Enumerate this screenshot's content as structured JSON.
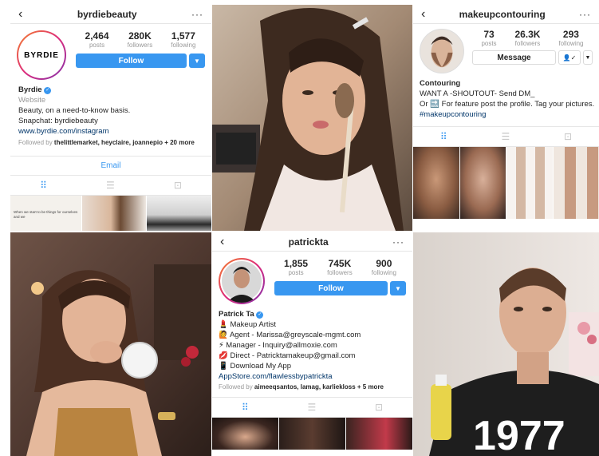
{
  "byrdie": {
    "username": "byrdiebeauty",
    "avatar_text": "BYRDIE",
    "stats": [
      {
        "value": "2,464",
        "label": "posts"
      },
      {
        "value": "280K",
        "label": "followers"
      },
      {
        "value": "1,577",
        "label": "following"
      }
    ],
    "follow_label": "Follow",
    "name": "Byrdie",
    "category": "Website",
    "bio_lines": [
      "Beauty, on a need-to-know basis.",
      "Snapchat: byrdiebeauty"
    ],
    "link": "www.byrdie.com/instagram",
    "followed_by_prefix": "Followed by ",
    "followed_by_names": "thelittlemarket, heyclaire, joannepio",
    "followed_by_suffix": " + 20 more",
    "email_label": "Email"
  },
  "makeup": {
    "username": "makeupcontouring",
    "stats": [
      {
        "value": "73",
        "label": "posts"
      },
      {
        "value": "26.3K",
        "label": "followers"
      },
      {
        "value": "293",
        "label": "following"
      }
    ],
    "message_label": "Message",
    "name": "Contouring",
    "bio_lines": [
      "WANT A -SHOUTOUT- Send DM_",
      "Or 🔜 For feature post the profile. Tag your pictures.",
      "#makeupcontouring"
    ]
  },
  "patrick": {
    "username": "patrickta",
    "stats": [
      {
        "value": "1,855",
        "label": "posts"
      },
      {
        "value": "745K",
        "label": "followers"
      },
      {
        "value": "900",
        "label": "following"
      }
    ],
    "follow_label": "Follow",
    "name": "Patrick Ta",
    "bio_lines": [
      "💄 Makeup Artist",
      "🙋 Agent - Marissa@greyscale-mgmt.com",
      "⚡ Manager - Inquiry@allmoxie.com",
      "💋 Direct - Patricktamakeup@gmail.com",
      "📱 Download My App"
    ],
    "link": "AppStore.com/flawlessbypatrickta",
    "followed_by_prefix": "Followed by ",
    "followed_by_names": "aimeeqsantos, lamag, karliekloss",
    "followed_by_suffix": " + 5 more"
  },
  "photo_text": {
    "shirt_number": "1977",
    "byrdie_thumb_caption": "When we start to be things for ourselves and we"
  },
  "icons": {
    "back": "‹",
    "more": "···",
    "caret": "▼",
    "grid": "⠿",
    "list": "☰",
    "tagged": "⊡",
    "user_check": "👤✓"
  },
  "colors": {
    "accent": "#3897f0",
    "link": "#003569",
    "muted": "#999999"
  }
}
